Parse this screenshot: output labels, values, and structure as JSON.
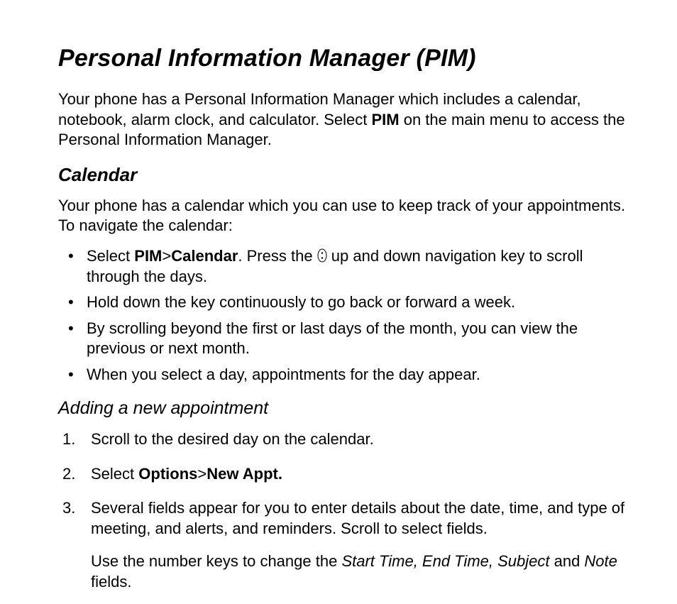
{
  "title": "Personal Information Manager (PIM)",
  "intro_pre": "Your phone has a Personal Information Manager which includes a calendar, notebook, alarm clock, and calculator. Select ",
  "intro_pim": "PIM",
  "intro_post": " on the main menu to access the Personal Information Manager.",
  "calendar": {
    "heading": "Calendar",
    "lead": "Your phone has a calendar which you can use to keep track of your appointments. To navigate the calendar:",
    "bullets": {
      "b1_preSelect": "Select ",
      "b1_pim": "PIM",
      "b1_gt": ">",
      "b1_cal": "Calendar",
      "b1_afterCal": ". Press the ",
      "b1_afterIcon": " up and down navigation key to scroll through the days.",
      "b2": "Hold down the key continuously to go back or forward a week.",
      "b3": "By scrolling beyond the first or last days of the month, you can view the previous or next month.",
      "b4": "When you select a day, appointments for the day appear."
    }
  },
  "adding": {
    "heading": "Adding a new appointment",
    "step1": "Scroll to the desired day on the calendar.",
    "step2_pre": "Select ",
    "step2_options": "Options",
    "step2_gt": ">",
    "step2_new": "New Appt.",
    "step3_main": "Several fields appear for you to enter details about the date, time, and type of meeting, and alerts, and reminders. Scroll to select fields.",
    "step3_sub_pre": "Use the number keys to change the ",
    "step3_sub_f1": "Start Time, End Time, Subject",
    "step3_sub_mid": " and ",
    "step3_sub_f2": "Note",
    "step3_sub_post": " fields."
  }
}
